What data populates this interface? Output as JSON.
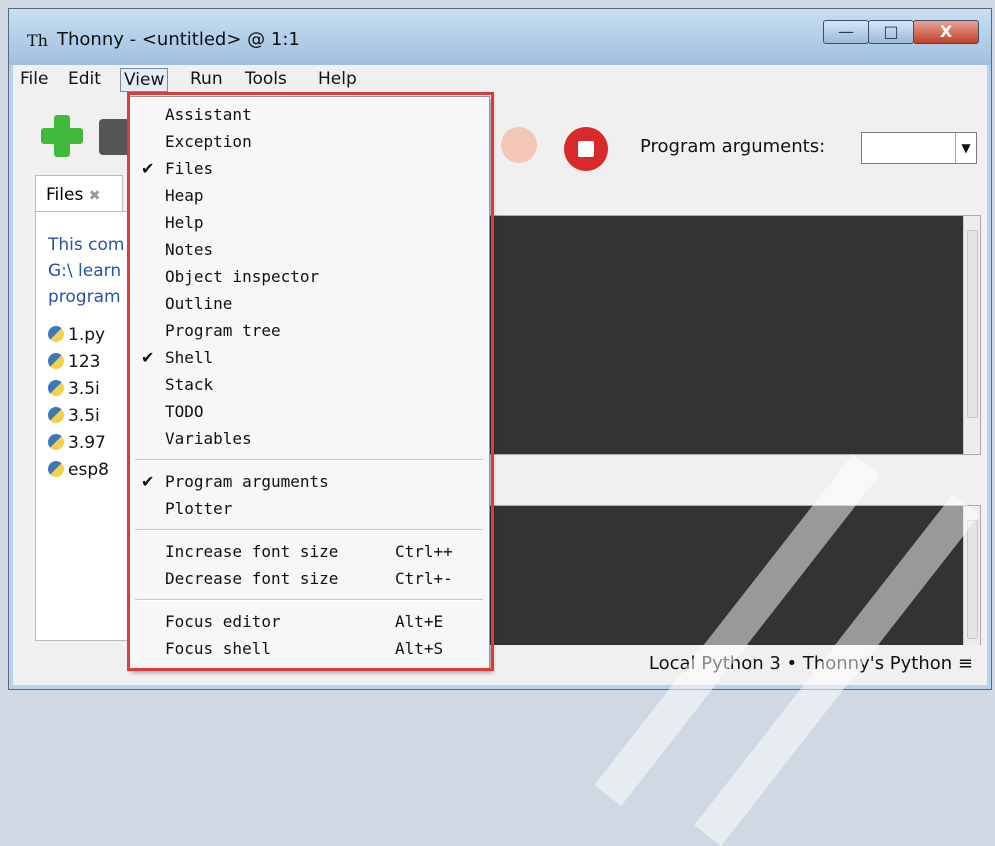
{
  "window": {
    "title": "Thonny  -  <untitled>  @  1:1",
    "controls": {
      "minimize": "—",
      "maximize": "□",
      "close": "X"
    }
  },
  "menubar": [
    "File",
    "Edit",
    "View",
    "Run",
    "Tools",
    "Help"
  ],
  "toolbar": {
    "program_arguments_label": "Program arguments:",
    "program_arguments_value": ""
  },
  "files_panel": {
    "tab_label": "Files",
    "tab_close": "✖",
    "location": "This com\nG:\\ learn\nprogram",
    "items": [
      "1.py",
      "123",
      "3.5i",
      "3.5i",
      "3.97",
      "esp8"
    ]
  },
  "view_menu": {
    "items": [
      {
        "label": "Assistant",
        "checked": false
      },
      {
        "label": "Exception",
        "checked": false
      },
      {
        "label": "Files",
        "checked": true
      },
      {
        "label": "Heap",
        "checked": false
      },
      {
        "label": "Help",
        "checked": false
      },
      {
        "label": "Notes",
        "checked": false
      },
      {
        "label": "Object inspector",
        "checked": false
      },
      {
        "label": "Outline",
        "checked": false
      },
      {
        "label": "Program tree",
        "checked": false
      },
      {
        "label": "Shell",
        "checked": true
      },
      {
        "label": "Stack",
        "checked": false
      },
      {
        "label": "TODO",
        "checked": false
      },
      {
        "label": "Variables",
        "checked": false
      },
      {
        "label": "Program arguments",
        "checked": true
      },
      {
        "label": "Plotter",
        "checked": false
      },
      {
        "label": "Increase font size",
        "shortcut": "Ctrl++"
      },
      {
        "label": "Decrease font size",
        "shortcut": "Ctrl+-"
      },
      {
        "label": "Focus editor",
        "shortcut": "Alt+E"
      },
      {
        "label": "Focus shell",
        "shortcut": "Alt+S"
      }
    ],
    "check_glyph": "✔"
  },
  "status_bar": {
    "text": "Local Python 3  •  Thonny's Python  ≡"
  },
  "colors": {
    "highlight_border": "#e03a3a",
    "editor_bg": "#333333",
    "location_text": "#2753a8"
  }
}
